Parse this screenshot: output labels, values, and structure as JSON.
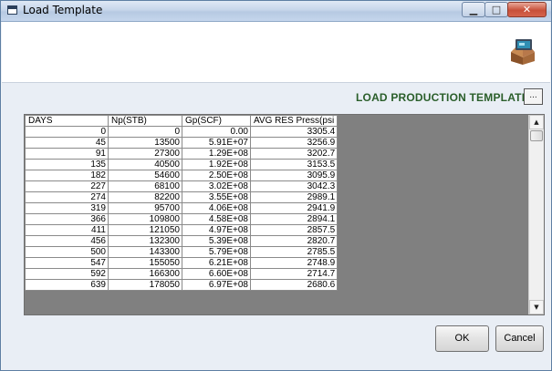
{
  "window": {
    "title": "Load Template",
    "minimize_glyph": "▁",
    "maximize_glyph": "□",
    "close_glyph": "✕"
  },
  "header": {
    "load_label": "LOAD PRODUCTION TEMPLATE",
    "browse_label": "..."
  },
  "grid": {
    "columns": [
      "DAYS",
      "Np(STB)",
      "Gp(SCF)",
      "AVG RES Press(psi"
    ],
    "rows": [
      [
        "0",
        "0",
        "0.00",
        "3305.4"
      ],
      [
        "45",
        "13500",
        "5.91E+07",
        "3256.9"
      ],
      [
        "91",
        "27300",
        "1.29E+08",
        "3202.7"
      ],
      [
        "135",
        "40500",
        "1.92E+08",
        "3153.5"
      ],
      [
        "182",
        "54600",
        "2.50E+08",
        "3095.9"
      ],
      [
        "227",
        "68100",
        "3.02E+08",
        "3042.3"
      ],
      [
        "274",
        "82200",
        "3.55E+08",
        "2989.1"
      ],
      [
        "319",
        "95700",
        "4.06E+08",
        "2941.9"
      ],
      [
        "366",
        "109800",
        "4.58E+08",
        "2894.1"
      ],
      [
        "411",
        "121050",
        "4.97E+08",
        "2857.5"
      ],
      [
        "456",
        "132300",
        "5.39E+08",
        "2820.7"
      ],
      [
        "500",
        "143300",
        "5.79E+08",
        "2785.5"
      ],
      [
        "547",
        "155050",
        "6.21E+08",
        "2748.9"
      ],
      [
        "592",
        "166300",
        "6.60E+08",
        "2714.7"
      ],
      [
        "639",
        "178050",
        "6.97E+08",
        "2680.6"
      ]
    ],
    "scroll_up_glyph": "▲",
    "scroll_down_glyph": "▼"
  },
  "buttons": {
    "ok": "OK",
    "cancel": "Cancel"
  },
  "colors": {
    "label_green": "#2a5e2a",
    "grid_empty": "#808080"
  }
}
